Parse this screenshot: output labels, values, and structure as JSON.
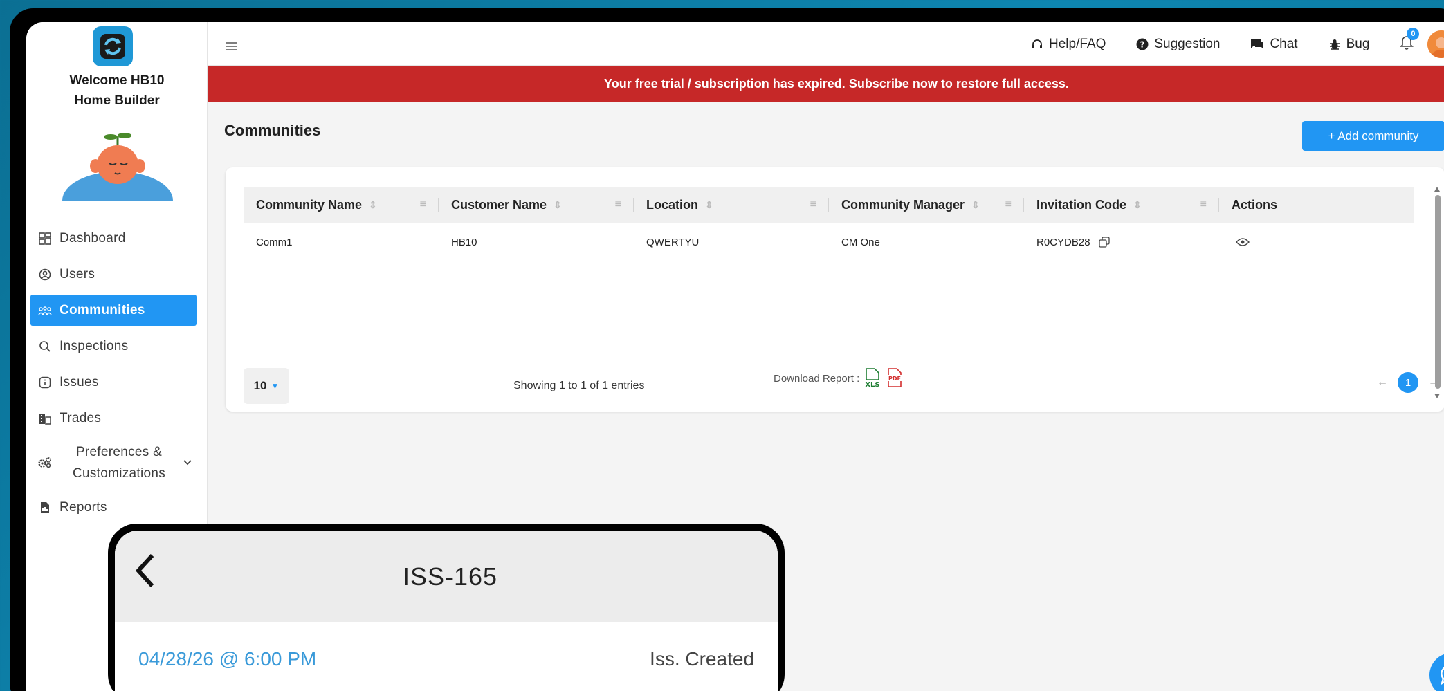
{
  "sidebar": {
    "welcome_line1": "Welcome HB10",
    "welcome_line2": "Home Builder",
    "items": [
      {
        "label": "Dashboard",
        "icon": "dashboard-icon"
      },
      {
        "label": "Users",
        "icon": "user-icon"
      },
      {
        "label": "Communities",
        "icon": "community-icon",
        "active": true
      },
      {
        "label": "Inspections",
        "icon": "search-icon"
      },
      {
        "label": "Issues",
        "icon": "info-icon"
      },
      {
        "label": "Trades",
        "icon": "building-icon"
      },
      {
        "label": "Preferences & Customizations",
        "icon": "gears-icon"
      },
      {
        "label": "Reports",
        "icon": "report-icon"
      }
    ]
  },
  "topbar": {
    "help": "Help/FAQ",
    "suggestion": "Suggestion",
    "chat": "Chat",
    "bug": "Bug",
    "notification_count": "0"
  },
  "banner": {
    "prefix": "Your free trial / subscription has expired.",
    "link": "Subscribe now",
    "suffix": "to restore full access."
  },
  "page": {
    "title": "Communities",
    "add_button": "+ Add community"
  },
  "table": {
    "columns": [
      "Community Name",
      "Customer Name",
      "Location",
      "Community Manager",
      "Invitation Code",
      "Actions"
    ],
    "rows": [
      {
        "community_name": "Comm1",
        "customer_name": "HB10",
        "location": "QWERTYU",
        "manager": "CM One",
        "invitation_code": "R0CYDB28"
      }
    ]
  },
  "footer": {
    "page_size": "10",
    "showing": "Showing 1 to 1 of 1 entries",
    "download_label": "Download Report :",
    "current_page": "1"
  },
  "phone": {
    "title": "ISS-165",
    "date": "04/28/26 @ 6:00 PM",
    "status": "Iss. Created"
  },
  "colors": {
    "accent": "#2196f3",
    "banner": "#c62828",
    "background": "#0e86b1"
  }
}
